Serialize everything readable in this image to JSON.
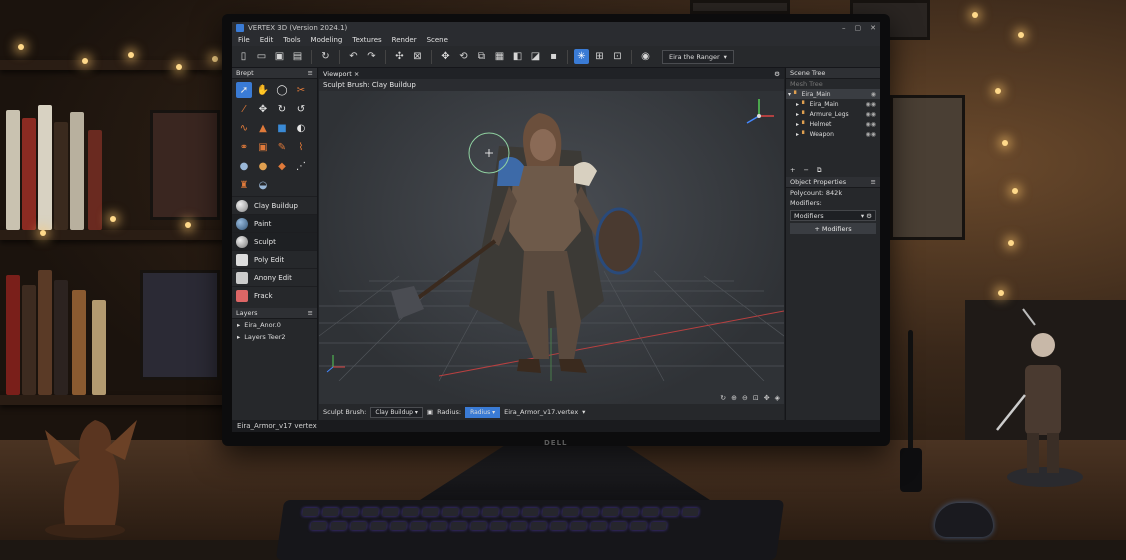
{
  "app": {
    "title": "VERTEX 3D (Version 2024.1)",
    "win_controls": [
      "–",
      "▢",
      "✕"
    ]
  },
  "menu": [
    "File",
    "Edit",
    "Tools",
    "Modeling",
    "Textures",
    "Render",
    "Scene"
  ],
  "toolbar": {
    "scene_selector": "Eira the Ranger"
  },
  "brept_panel": {
    "title": "Brept",
    "brushes": [
      {
        "label": "Clay Buildup",
        "icon": "sphere-icon"
      },
      {
        "label": "Paint",
        "icon": "paint-brush-icon"
      },
      {
        "label": "Sculpt",
        "icon": "sculpt-icon"
      },
      {
        "label": "Poly Edit",
        "icon": "poly-edit-icon"
      },
      {
        "label": "Anony Edit",
        "icon": "anony-edit-icon"
      },
      {
        "label": "Frack",
        "icon": "frack-icon"
      }
    ]
  },
  "layers_panel": {
    "title": "Layers",
    "items": [
      "Eira_Anor.0",
      "Layers Teer2"
    ]
  },
  "viewport": {
    "tab": "Viewport",
    "tab_close": "×",
    "header": "Sculpt Brush: Clay Buildup",
    "bottom": {
      "brush_label": "Sculpt Brush:",
      "brush_value": "Clay Buildup",
      "radius_label": "Radius:",
      "radius_value": "Radius",
      "file_value": "Eira_Armor_v17.vertex"
    }
  },
  "scene_tree": {
    "title": "Scene Tree",
    "filter": "Mesh Tree",
    "items": [
      {
        "label": "Eira_Main",
        "level": 0,
        "selected": true
      },
      {
        "label": "Eira_Main",
        "level": 1
      },
      {
        "label": "Armure_Legs",
        "level": 1
      },
      {
        "label": "Helmet",
        "level": 1
      },
      {
        "label": "Weapon",
        "level": 1
      }
    ],
    "actions": [
      "+",
      "−",
      "⧉"
    ]
  },
  "object_properties": {
    "title": "Object Properties",
    "polycount": "Polycount: 842k",
    "modifiers_label": "Modifiers:",
    "modifiers_select": "Modifiers",
    "add_modifier": "+ Modifiers"
  },
  "statusbar": {
    "file": "Eira_Armor_v17 vertex"
  },
  "monitor_brand": "DELL",
  "colors": {
    "accent": "#3a7bd5",
    "panel": "#26282b",
    "viewport_bg": "#2f3236"
  }
}
